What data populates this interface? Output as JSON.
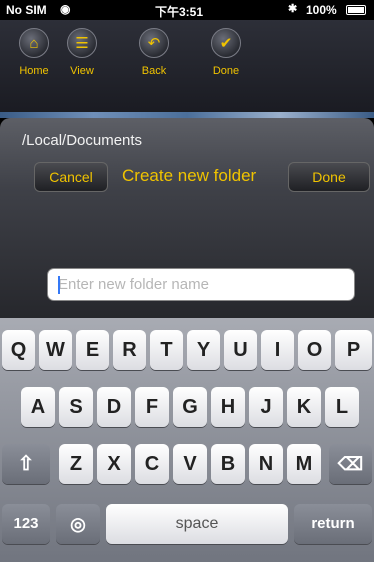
{
  "status_bar": {
    "carrier": "No SIM",
    "wifi_icon": "wifi-icon",
    "time": "下午3:51",
    "battery": "100%"
  },
  "toolbar": {
    "home": "Home",
    "view": "View",
    "back": "Back",
    "done": "Done"
  },
  "dialog": {
    "path": "/Local/Documents",
    "cancel": "Cancel",
    "title": "Create new folder",
    "done": "Done",
    "input_placeholder": "Enter new folder name",
    "input_value": ""
  },
  "keyboard": {
    "row1": [
      "Q",
      "W",
      "E",
      "R",
      "T",
      "Y",
      "U",
      "I",
      "O",
      "P"
    ],
    "row2": [
      "A",
      "S",
      "D",
      "F",
      "G",
      "H",
      "J",
      "K",
      "L"
    ],
    "row3": [
      "Z",
      "X",
      "C",
      "V",
      "B",
      "N",
      "M"
    ],
    "numbers_key": "123",
    "space_key": "space",
    "return_key": "return"
  },
  "colors": {
    "accent_yellow": "#f0c300",
    "toolbar_bg": "#1f2027"
  }
}
